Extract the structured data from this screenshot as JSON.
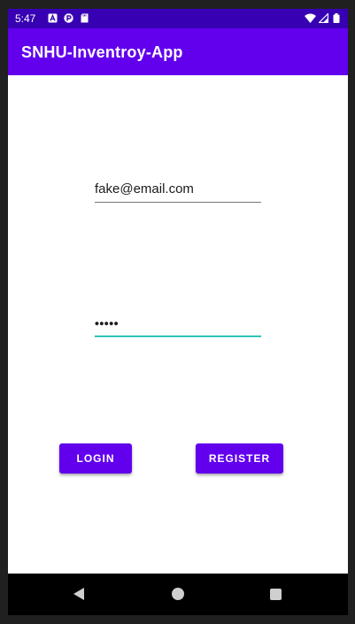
{
  "status_bar": {
    "time": "5:47",
    "left_icons": [
      "a-notification-icon",
      "circle-app-icon",
      "sd-card-icon"
    ],
    "right_icons": [
      "wifi-icon",
      "signal-icon",
      "battery-icon"
    ]
  },
  "app_bar": {
    "title": "SNHU-Inventroy-App"
  },
  "form": {
    "email_value": "fake@email.com",
    "password_value": "•••••"
  },
  "buttons": {
    "login_label": "LOGIN",
    "register_label": "REGISTER"
  },
  "nav_bar": {
    "icons": [
      "back-icon",
      "home-icon",
      "recents-icon"
    ]
  },
  "colors": {
    "status_bar": "#3700b3",
    "primary": "#6200ee",
    "accent": "#2ec6b6"
  }
}
